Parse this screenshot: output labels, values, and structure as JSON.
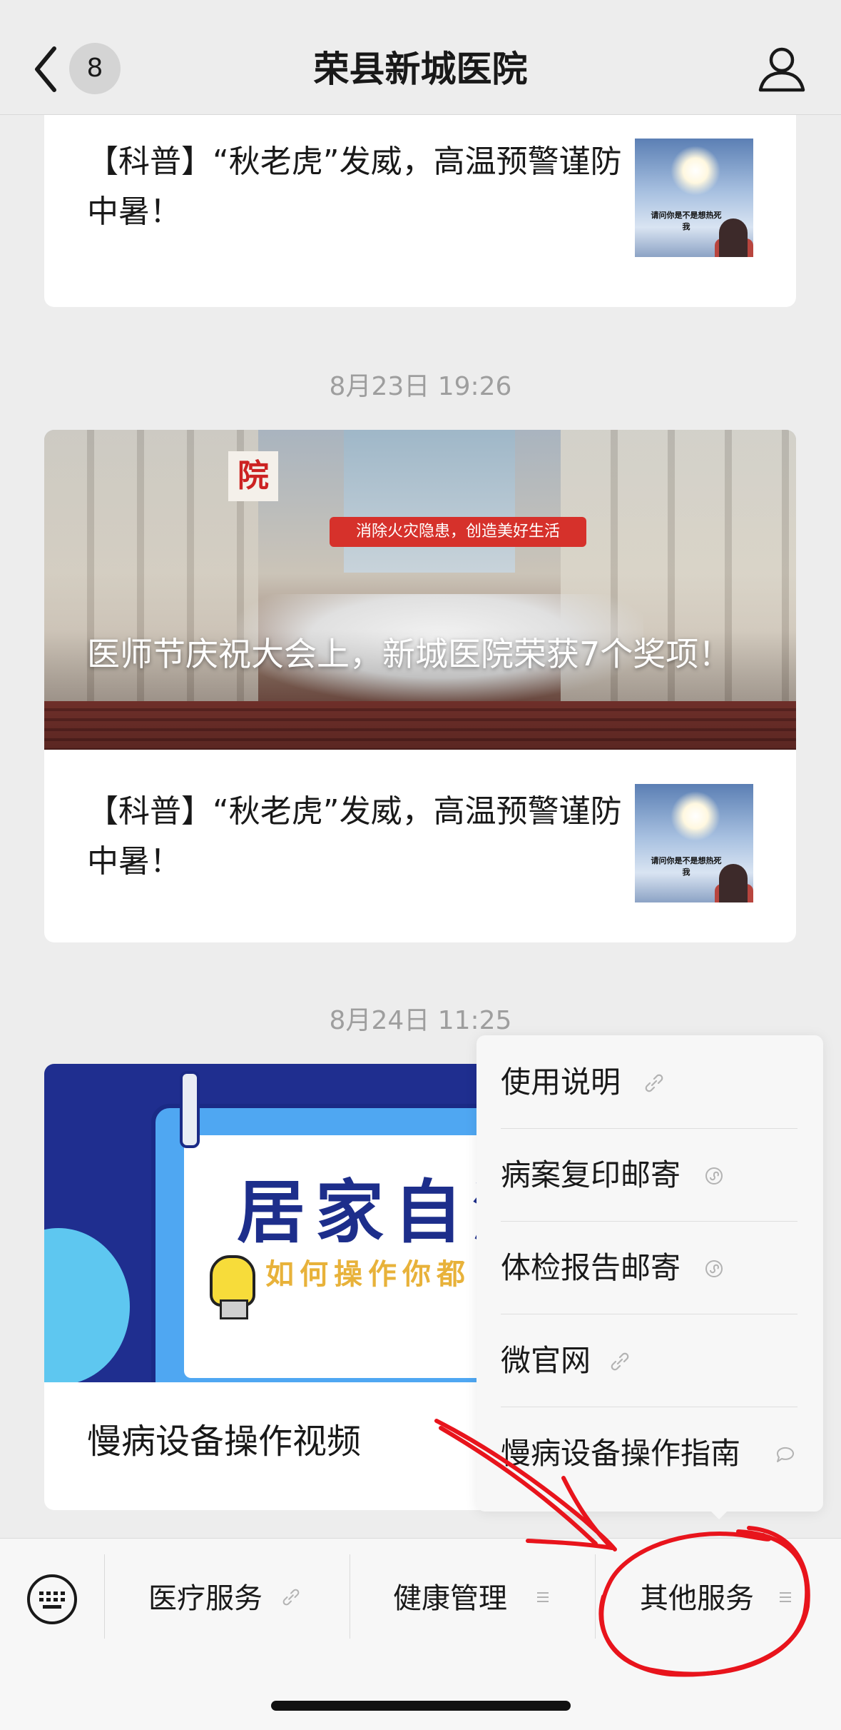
{
  "header": {
    "title": "荣县新城医院",
    "unread_count": "8"
  },
  "feed": {
    "card1": {
      "text": "【科普】“秋老虎”发威，高温预警谨防中暑！",
      "thumb_caption": "请问你是不是想热死我"
    },
    "timestamp2": "8月23日 19:26",
    "card2": {
      "cover_title": "医师节庆祝大会上，新城医院荣获7个奖项！",
      "cover_banner": "消除火灾隐患，创造美好生活",
      "cover_sign": "院",
      "item_text": "【科普】“秋老虎”发威，高温预警谨防中暑！",
      "thumb_caption": "请问你是不是想热死我"
    },
    "timestamp3": "8月24日 11:25",
    "card3": {
      "cover_big": "居家自测",
      "cover_small": "如何操作你都",
      "title": "慢病设备操作视频"
    }
  },
  "menu": {
    "items": [
      {
        "label": "使用说明",
        "icon": "link-icon"
      },
      {
        "label": "病案复印邮寄",
        "icon": "mini-program-icon"
      },
      {
        "label": "体检报告邮寄",
        "icon": "mini-program-icon"
      },
      {
        "label": "微官网",
        "icon": "link-icon"
      },
      {
        "label": "慢病设备操作指南",
        "icon": "message-icon"
      }
    ]
  },
  "bottom_bar": {
    "tabs": [
      {
        "label": "医疗服务",
        "icon": "link-icon"
      },
      {
        "label": "健康管理",
        "icon": "menu-icon"
      },
      {
        "label": "其他服务",
        "icon": "menu-icon"
      }
    ]
  },
  "colors": {
    "background": "#ededed",
    "annotation": "#e8141c"
  }
}
